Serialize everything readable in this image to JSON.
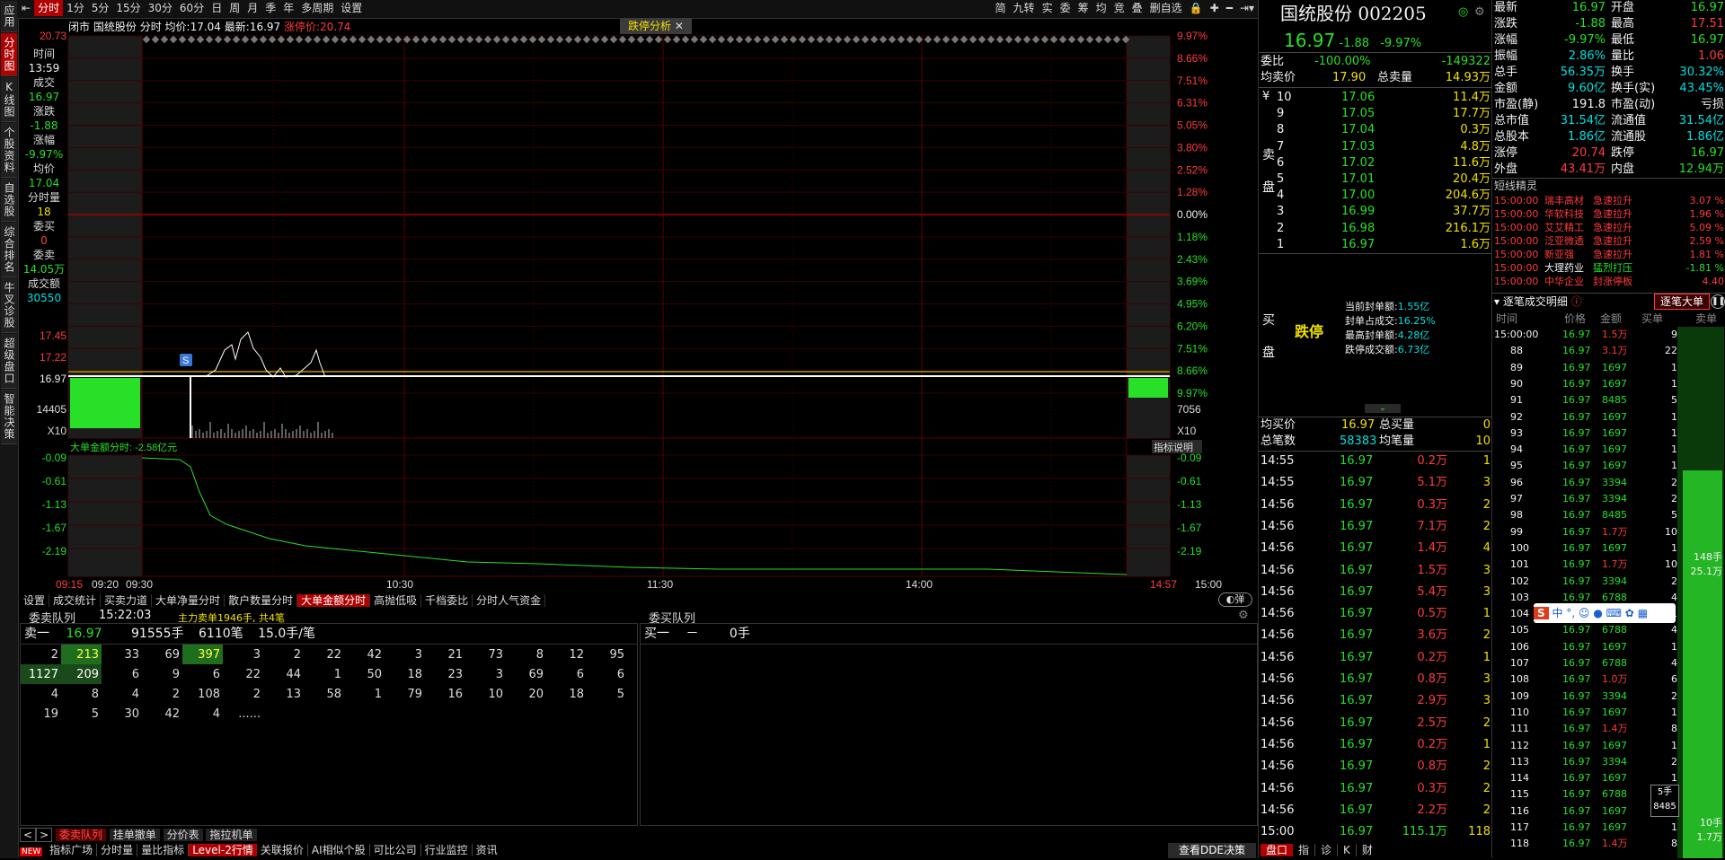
{
  "left_tabs": [
    "应用",
    "分时图",
    "K线图",
    "个股资料",
    "自选股",
    "综合排名",
    "牛叉诊股",
    "超级盘口",
    "智能决策"
  ],
  "topbar": {
    "items": [
      "分时",
      "1分",
      "5分",
      "15分",
      "30分",
      "60分",
      "日",
      "周",
      "月",
      "季",
      "年",
      "多周期",
      "设置"
    ],
    "right_items": [
      "简",
      "九转",
      "实",
      "委",
      "筹",
      "均",
      "竞",
      "叠",
      "删自选"
    ]
  },
  "info": {
    "label1": "闭市",
    "name": "国统股份",
    "mode": "分时",
    "avg_label": "均价:",
    "avg": "17.04",
    "last_label": "最新:",
    "last": "16.97",
    "limit_label": "涨停价:",
    "limit": "20.74"
  },
  "fall_badge": "跌停分析",
  "left_info": [
    {
      "k": "时间",
      "v": "13:59",
      "c": "white"
    },
    {
      "k": "成交",
      "v": "16.97",
      "c": "green"
    },
    {
      "k": "涨跌",
      "v": "-1.88",
      "c": "green"
    },
    {
      "k": "涨幅",
      "v": "-9.97%",
      "c": "green"
    },
    {
      "k": "均价",
      "v": "17.04",
      "c": "green"
    },
    {
      "k": "分时量",
      "v": "18",
      "c": "yellow"
    },
    {
      "k": "委买",
      "v": "0",
      "c": "red"
    },
    {
      "k": "委卖",
      "v": "14.05万",
      "c": "green"
    },
    {
      "k": "成交额",
      "v": "30550",
      "c": "cyan"
    }
  ],
  "price_axis_left": [
    "20.73",
    "17.45",
    "17.22",
    "16.97",
    "14405",
    "X10"
  ],
  "pct_axis_right": [
    "9.97%",
    "8.66%",
    "7.51%",
    "6.31%",
    "5.05%",
    "3.80%",
    "2.52%",
    "1.28%",
    "0.00%",
    "1.18%",
    "2.43%",
    "3.69%",
    "4.95%",
    "6.20%",
    "7.51%",
    "8.66%",
    "9.97%",
    "7056",
    "X10"
  ],
  "sub_axis_left": [
    "-0.09",
    "-0.61",
    "-1.13",
    "-1.67",
    "-2.19"
  ],
  "sub_axis_right": [
    "-0.09",
    "-0.61",
    "-1.13",
    "-1.67",
    "-2.19"
  ],
  "time_axis": [
    "09:15",
    "09:20",
    "09:30",
    "10:30",
    "11:30",
    "14:00",
    "14:57",
    "15:00"
  ],
  "sub_title": "大单金额分时: -2.58亿元",
  "indicator_btn": "指标说明",
  "marker_s": "S",
  "chart_tabs": [
    "设置",
    "成交统计",
    "买卖力道",
    "大单净量分时",
    "散户数量分时",
    "大单金额分时",
    "高抛低吸",
    "千档委比",
    "分时人气资金"
  ],
  "chart_tab_active": 5,
  "bomb_label": "弹",
  "queue": {
    "sell_title": "委卖队列",
    "time": "15:22:03",
    "note": "主力卖单1946手, 共4笔",
    "buy_title": "委买队列",
    "sell1_label": "卖一",
    "sell1_price": "16.97",
    "sell1_vol": "91555手",
    "sell1_count": "6110笔",
    "sell1_avg": "15.0手/笔",
    "buy1_label": "买一",
    "buy1_price": "－",
    "buy1_vol": "0手",
    "rows": [
      [
        "2",
        "213",
        "33",
        "69",
        "397",
        "3",
        "2",
        "22",
        "42",
        "3",
        "21",
        "73",
        "8",
        "12",
        "95"
      ],
      [
        "1127",
        "209",
        "6",
        "9",
        "6",
        "22",
        "44",
        "1",
        "50",
        "18",
        "23",
        "3",
        "69",
        "6",
        "6"
      ],
      [
        "4",
        "8",
        "4",
        "2",
        "108",
        "2",
        "13",
        "58",
        "1",
        "79",
        "16",
        "10",
        "20",
        "18",
        "5"
      ],
      [
        "19",
        "5",
        "30",
        "42",
        "4",
        "......",
        "",
        "",
        "",
        "",
        "",
        "",
        "",
        "",
        ""
      ]
    ]
  },
  "bottom_tabs": [
    "委卖队列",
    "挂单撤单",
    "分价表",
    "拖拉机单"
  ],
  "status_bar": [
    "NEW",
    "指标广场",
    "分时量",
    "量比指标",
    "Level-2行情",
    "关联报价",
    "AI相似个股",
    "可比公司",
    "行业监控",
    "资讯"
  ],
  "dde_btn": "查看DDE决策",
  "stock": {
    "name": "国统股份",
    "code": "002205",
    "price": "16.97",
    "chg": "-1.88",
    "pct": "-9.97%"
  },
  "committee": {
    "label": "委比",
    "pct": "-100.00%",
    "diff": "-149322"
  },
  "sell_avg": {
    "l": "均卖价",
    "v": "17.90",
    "l2": "总卖量",
    "v2": "14.93万"
  },
  "asks": [
    {
      "lvl": "10",
      "p": "17.06",
      "v": "11.4万"
    },
    {
      "lvl": "9",
      "p": "17.05",
      "v": "17.7万"
    },
    {
      "lvl": "8",
      "p": "17.04",
      "v": "0.3万"
    },
    {
      "lvl": "7",
      "p": "17.03",
      "v": "4.8万"
    },
    {
      "lvl": "6",
      "p": "17.02",
      "v": "11.6万"
    },
    {
      "lvl": "5",
      "p": "17.01",
      "v": "20.4万"
    },
    {
      "lvl": "4",
      "p": "17.00",
      "v": "204.6万"
    },
    {
      "lvl": "3",
      "p": "16.99",
      "v": "37.7万"
    },
    {
      "lvl": "2",
      "p": "16.98",
      "v": "216.1万"
    },
    {
      "lvl": "1",
      "p": "16.97",
      "v": "1.6万"
    }
  ],
  "ask_side": [
    "¥",
    "卖",
    "盘"
  ],
  "bid_side": [
    "买",
    "盘"
  ],
  "limit_down": "跌停",
  "limit_info": [
    {
      "k": "当前封单额:",
      "v": "1.55亿"
    },
    {
      "k": "封单占成交:",
      "v": "16.25%"
    },
    {
      "k": "最高封单额:",
      "v": "4.28亿"
    },
    {
      "k": "跌停成交额:",
      "v": "6.73亿"
    }
  ],
  "buy_avg": {
    "l": "均买价",
    "v": "16.97",
    "l2": "总买量",
    "v2": "0"
  },
  "total": {
    "l": "总笔数",
    "v": "58383",
    "l2": "均笔量",
    "v2": "10"
  },
  "ticks": [
    {
      "t": "14:55",
      "p": "16.97",
      "a": "0.2万",
      "n": "1"
    },
    {
      "t": "14:55",
      "p": "16.97",
      "a": "5.1万",
      "n": "3"
    },
    {
      "t": "14:56",
      "p": "16.97",
      "a": "0.3万",
      "n": "2"
    },
    {
      "t": "14:56",
      "p": "16.97",
      "a": "7.1万",
      "n": "2"
    },
    {
      "t": "14:56",
      "p": "16.97",
      "a": "1.4万",
      "n": "4"
    },
    {
      "t": "14:56",
      "p": "16.97",
      "a": "1.5万",
      "n": "3"
    },
    {
      "t": "14:56",
      "p": "16.97",
      "a": "5.4万",
      "n": "3"
    },
    {
      "t": "14:56",
      "p": "16.97",
      "a": "0.5万",
      "n": "1"
    },
    {
      "t": "14:56",
      "p": "16.97",
      "a": "3.6万",
      "n": "2"
    },
    {
      "t": "14:56",
      "p": "16.97",
      "a": "0.2万",
      "n": "1"
    },
    {
      "t": "14:56",
      "p": "16.97",
      "a": "0.8万",
      "n": "3"
    },
    {
      "t": "14:56",
      "p": "16.97",
      "a": "2.9万",
      "n": "3"
    },
    {
      "t": "14:56",
      "p": "16.97",
      "a": "2.5万",
      "n": "2"
    },
    {
      "t": "14:56",
      "p": "16.97",
      "a": "0.2万",
      "n": "1"
    },
    {
      "t": "14:56",
      "p": "16.97",
      "a": "0.8万",
      "n": "2"
    },
    {
      "t": "14:56",
      "p": "16.97",
      "a": "0.3万",
      "n": "2"
    },
    {
      "t": "14:56",
      "p": "16.97",
      "a": "2.2万",
      "n": "2"
    },
    {
      "t": "15:00",
      "p": "16.97",
      "a": "115.1万",
      "n": "118"
    }
  ],
  "bottom_right_tabs": [
    "盘口",
    "指",
    "诊",
    "K",
    "财"
  ],
  "quote": [
    {
      "k": "最新",
      "v": "16.97",
      "k2": "开盘",
      "v2": "16.97",
      "c": "green",
      "c2": "green"
    },
    {
      "k": "涨跌",
      "v": "-1.88",
      "k2": "最高",
      "v2": "17.51",
      "c": "green",
      "c2": "red"
    },
    {
      "k": "涨幅",
      "v": "-9.97%",
      "k2": "最低",
      "v2": "16.97",
      "c": "green",
      "c2": "green"
    },
    {
      "k": "振幅",
      "v": "2.86%",
      "k2": "量比",
      "v2": "1.06",
      "c": "cyan",
      "c2": "red"
    },
    {
      "k": "总手",
      "v": "56.35万",
      "k2": "换手",
      "v2": "30.32%",
      "c": "cyan",
      "c2": "cyan"
    },
    {
      "k": "金额",
      "v": "9.60亿",
      "k2": "换手(实)",
      "v2": "43.45%",
      "c": "cyan",
      "c2": "cyan"
    },
    {
      "k": "市盈(静)",
      "v": "191.8",
      "k2": "市盈(动)",
      "v2": "亏损",
      "c": "white",
      "c2": "white"
    },
    {
      "k": "总市值",
      "v": "31.54亿",
      "k2": "流通值",
      "v2": "31.54亿",
      "c": "cyan",
      "c2": "cyan"
    },
    {
      "k": "总股本",
      "v": "1.86亿",
      "k2": "流通股",
      "v2": "1.86亿",
      "c": "cyan",
      "c2": "cyan"
    },
    {
      "k": "涨停",
      "v": "20.74",
      "k2": "跌停",
      "v2": "16.97",
      "c": "red",
      "c2": "green"
    },
    {
      "k": "外盘",
      "v": "43.41万",
      "k2": "内盘",
      "v2": "12.94万",
      "c": "red",
      "c2": "green"
    }
  ],
  "short_title": "短线精灵",
  "short_lines": [
    {
      "t": "15:00:00",
      "n": "瑞丰高材",
      "e": "急速拉升",
      "p": "3.07 %"
    },
    {
      "t": "15:00:00",
      "n": "华软科技",
      "e": "急速拉升",
      "p": "1.96 %"
    },
    {
      "t": "15:00:00",
      "n": "艾艾精工",
      "e": "急速拉升",
      "p": "5.09 %"
    },
    {
      "t": "15:00:00",
      "n": "泛亚微透",
      "e": "急速拉升",
      "p": "2.59 %"
    },
    {
      "t": "15:00:00",
      "n": "新亚强",
      "e": "急速拉升",
      "p": "1.81 %"
    },
    {
      "t": "15:00:00",
      "n": "大理药业",
      "e": "猛烈打压",
      "p": "-1.81 %"
    },
    {
      "t": "15:00:00",
      "n": "中华企业",
      "e": "封涨停板",
      "p": "4.40"
    }
  ],
  "detail": {
    "title": "逐笔成交明细",
    "big_btn": "逐笔大单",
    "headers": [
      "时间",
      "价格",
      "金额",
      "买单",
      "卖单"
    ]
  },
  "detail_rows": [
    {
      "t": "15:00:00",
      "p": "16.97",
      "a": "1.5万",
      "n": "9"
    },
    {
      "t": "88",
      "p": "16.97",
      "a": "3.1万",
      "n": "22"
    },
    {
      "t": "89",
      "p": "16.97",
      "a": "1697",
      "n": "1"
    },
    {
      "t": "90",
      "p": "16.97",
      "a": "1697",
      "n": "1"
    },
    {
      "t": "91",
      "p": "16.97",
      "a": "8485",
      "n": "5"
    },
    {
      "t": "92",
      "p": "16.97",
      "a": "1697",
      "n": "1"
    },
    {
      "t": "93",
      "p": "16.97",
      "a": "1697",
      "n": "1"
    },
    {
      "t": "94",
      "p": "16.97",
      "a": "1697",
      "n": "1"
    },
    {
      "t": "95",
      "p": "16.97",
      "a": "1697",
      "n": "1"
    },
    {
      "t": "96",
      "p": "16.97",
      "a": "3394",
      "n": "2"
    },
    {
      "t": "97",
      "p": "16.97",
      "a": "3394",
      "n": "2"
    },
    {
      "t": "98",
      "p": "16.97",
      "a": "8485",
      "n": "5"
    },
    {
      "t": "99",
      "p": "16.97",
      "a": "1.7万",
      "n": "10"
    },
    {
      "t": "100",
      "p": "16.97",
      "a": "1697",
      "n": "1"
    },
    {
      "t": "101",
      "p": "16.97",
      "a": "1.7万",
      "n": "10"
    },
    {
      "t": "102",
      "p": "16.97",
      "a": "3394",
      "n": "2"
    },
    {
      "t": "103",
      "p": "16.97",
      "a": "6788",
      "n": "4"
    },
    {
      "t": "104",
      "p": "16.97",
      "a": "1697",
      "n": "1"
    },
    {
      "t": "105",
      "p": "16.97",
      "a": "6788",
      "n": "4"
    },
    {
      "t": "106",
      "p": "16.97",
      "a": "1697",
      "n": "1"
    },
    {
      "t": "107",
      "p": "16.97",
      "a": "6788",
      "n": "4"
    },
    {
      "t": "108",
      "p": "16.97",
      "a": "1.0万",
      "n": "6"
    },
    {
      "t": "109",
      "p": "16.97",
      "a": "3394",
      "n": "2"
    },
    {
      "t": "110",
      "p": "16.97",
      "a": "1697",
      "n": "1"
    },
    {
      "t": "111",
      "p": "16.97",
      "a": "1.4万",
      "n": "8"
    },
    {
      "t": "112",
      "p": "16.97",
      "a": "1697",
      "n": "1"
    },
    {
      "t": "113",
      "p": "16.97",
      "a": "3394",
      "n": "2"
    },
    {
      "t": "114",
      "p": "16.97",
      "a": "1697",
      "n": "1"
    },
    {
      "t": "115",
      "p": "16.97",
      "a": "6788",
      "n": "4"
    },
    {
      "t": "116",
      "p": "16.97",
      "a": "1697",
      "n": "1"
    },
    {
      "t": "117",
      "p": "16.97",
      "a": "1697",
      "n": "1"
    },
    {
      "t": "118",
      "p": "16.97",
      "a": "1.4万",
      "n": "8"
    }
  ],
  "side_bar": {
    "v1": "148手",
    "v2": "25.1万",
    "v3": "5手",
    "v4": "8485",
    "v5": "10手",
    "v6": "1.7万"
  },
  "ime_bar": "中",
  "colors": {
    "red": "#ff3b3b",
    "green": "#27e027",
    "grid": "#5a0000",
    "bg": "#000000"
  }
}
